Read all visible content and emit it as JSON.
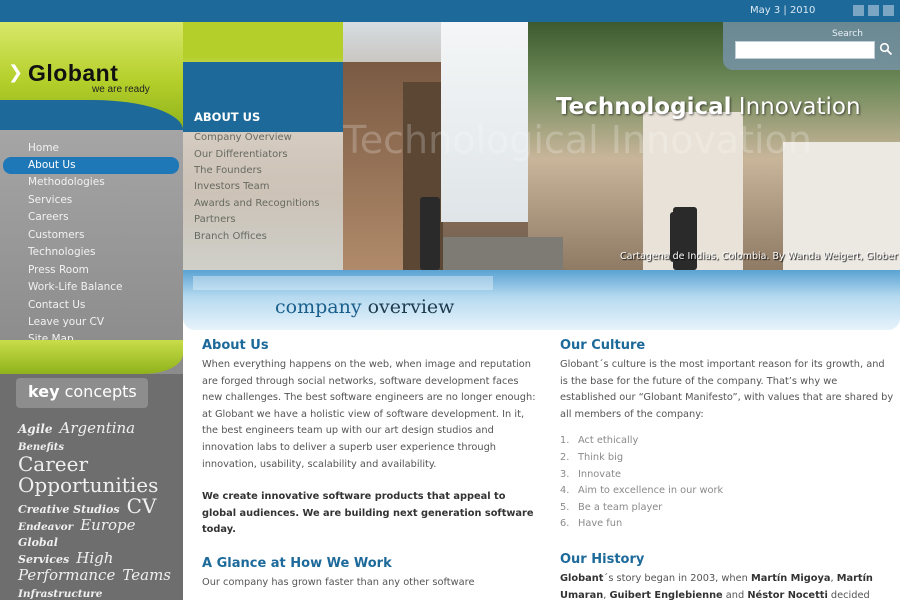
{
  "topbar": {
    "date": "May 3 | 2010"
  },
  "logo": {
    "name": "Globant",
    "tagline": "we are ready"
  },
  "nav": {
    "items": [
      {
        "label": "Home"
      },
      {
        "label": "About Us"
      },
      {
        "label": "Methodologies"
      },
      {
        "label": "Services"
      },
      {
        "label": "Careers"
      },
      {
        "label": "Customers"
      },
      {
        "label": "Technologies"
      },
      {
        "label": "Press Room"
      },
      {
        "label": "Work-Life Balance"
      },
      {
        "label": "Contact Us"
      },
      {
        "label": "Leave your CV"
      },
      {
        "label": "Site Map"
      }
    ],
    "active": "About Us"
  },
  "key_concepts": {
    "title_bold": "key",
    "title_rest": " concepts",
    "cloud": [
      "Agile",
      "Argentina",
      "Benefits",
      "Career",
      "Opportunities",
      "Creative Studios",
      "CV",
      "Endeavor",
      "Europe",
      "Global",
      "Services",
      "High",
      "Performance",
      "Teams",
      "Infrastructure Management"
    ]
  },
  "hero": {
    "about_label": "ABOUT US",
    "submenu": [
      {
        "label": "Company Overview"
      },
      {
        "label": "Our Differentiators"
      },
      {
        "label": "The Founders"
      },
      {
        "label": "Investors Team"
      },
      {
        "label": "Awards and Recognitions"
      },
      {
        "label": "Partners"
      },
      {
        "label": "Branch Offices"
      }
    ],
    "title_bold": "Technological",
    "title_rest": " Innovation",
    "caption": "Cartagena de Indias, Colombia. By Wanda Weigert, Glober"
  },
  "search": {
    "label": "Search",
    "value": ""
  },
  "section": {
    "title_word1": "company",
    "title_word2": " overview"
  },
  "about": {
    "heading": "About Us",
    "body": "When everything happens on the web, when image and reputation are forged through social networks, software development faces new challenges. The best software engineers are no longer enough: at Globant we have a holistic view of software development. In it, the best engineers team up with our art design studios and innovation labs to deliver a superb user experience through innovation, usability, scalability and availability.",
    "statement": "We create innovative software products that appeal to global audiences. We are building next generation software today."
  },
  "glance": {
    "heading": "A Glance at How We Work",
    "body": "Our company has grown faster than any other software"
  },
  "culture": {
    "heading": "Our Culture",
    "body": "Globant´s culture is the most important reason for its growth, and is the base for the future of the company. That’s why we established our “Globant Manifesto”, with values that are shared by all members of the company:",
    "values": [
      {
        "num": "1.",
        "text": "Act ethically"
      },
      {
        "num": "2.",
        "text": "Think big"
      },
      {
        "num": "3.",
        "text": "Innovate"
      },
      {
        "num": "4.",
        "text": "Aim to excellence in our work"
      },
      {
        "num": "5.",
        "text": "Be a team player"
      },
      {
        "num": "6.",
        "text": "Have fun"
      }
    ]
  },
  "history": {
    "heading": "Our History",
    "lead": "Globant",
    "text1": "´s story began in 2003, when ",
    "p1": "Martín Migoya",
    "text2": ", ",
    "p2": "Martín Umaran",
    "text3": ", ",
    "p3": "Guibert Englebienne",
    "text4": " and ",
    "p4": "Néstor Nocetti",
    "text5": " decided"
  },
  "colors": {
    "brand_blue": "#1d6a9a",
    "brand_green": "#b4cf2a",
    "nav_active": "#1e78b8"
  }
}
